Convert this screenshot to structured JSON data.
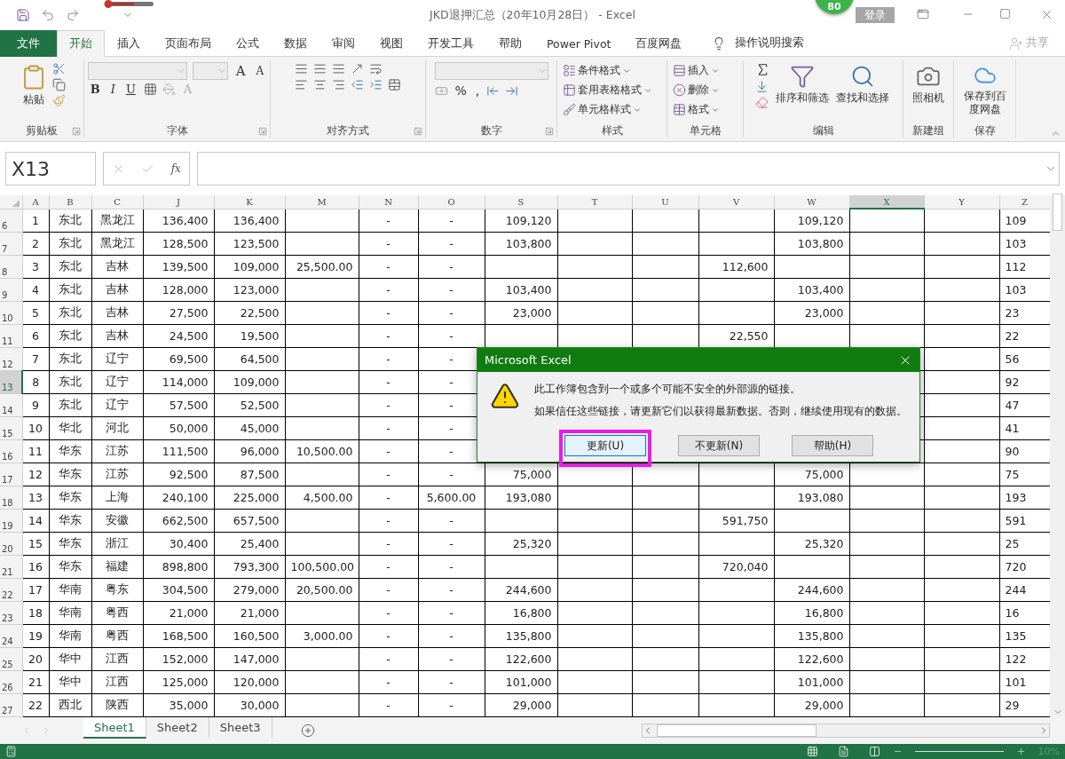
{
  "title_bar": {
    "title": "JKD退押汇总（20年10月28日） -  Excel",
    "badge": "80",
    "login": "登录"
  },
  "ribbon_tabs": [
    {
      "label": "文件",
      "kind": "file",
      "selected": false
    },
    {
      "label": "开始",
      "kind": "tab",
      "selected": true
    },
    {
      "label": "插入",
      "kind": "tab",
      "selected": false
    },
    {
      "label": "页面布局",
      "kind": "tab",
      "selected": false
    },
    {
      "label": "公式",
      "kind": "tab",
      "selected": false
    },
    {
      "label": "数据",
      "kind": "tab",
      "selected": false
    },
    {
      "label": "审阅",
      "kind": "tab",
      "selected": false
    },
    {
      "label": "视图",
      "kind": "tab",
      "selected": false
    },
    {
      "label": "开发工具",
      "kind": "tab",
      "selected": false
    },
    {
      "label": "帮助",
      "kind": "tab",
      "selected": false
    },
    {
      "label": "Power Pivot",
      "kind": "tab",
      "selected": false
    },
    {
      "label": "百度网盘",
      "kind": "tab",
      "selected": false
    }
  ],
  "tell_me": "操作说明搜索",
  "share": "共享",
  "ribbon_groups": [
    {
      "kind": "clipboard",
      "label": "剪贴板",
      "button": "粘贴"
    },
    {
      "kind": "font",
      "label": "字体",
      "size_buttons": [
        "A",
        "A"
      ],
      "style_buttons": [
        "B",
        "I",
        "U"
      ],
      "color_button": "A"
    },
    {
      "kind": "alignment",
      "label": "对齐方式"
    },
    {
      "kind": "number",
      "label": "数字",
      "symbols": [
        "%",
        ","
      ]
    },
    {
      "kind": "list",
      "label": "样式",
      "items": [
        "条件格式",
        "套用表格格式",
        "单元格样式"
      ]
    },
    {
      "kind": "list",
      "label": "单元格",
      "items": [
        "插入",
        "删除",
        "格式"
      ]
    },
    {
      "kind": "editing",
      "label": "编辑",
      "items": [
        "排序和筛选",
        "查找和选择"
      ]
    },
    {
      "kind": "camera",
      "label": "新建组",
      "button": "照相机"
    },
    {
      "kind": "cloud",
      "label": "保存",
      "button": "保存到百度网盘"
    }
  ],
  "formula_bar": {
    "name_box": "X13",
    "fx": "fx"
  },
  "columns": [
    {
      "label": "A",
      "kind": "center",
      "selected": false
    },
    {
      "label": "B",
      "kind": "center",
      "selected": false
    },
    {
      "label": "C",
      "kind": "center",
      "selected": false
    },
    {
      "label": "J",
      "kind": "number",
      "selected": false
    },
    {
      "label": "K",
      "kind": "number",
      "selected": false
    },
    {
      "label": "M",
      "kind": "number",
      "selected": false
    },
    {
      "label": "N",
      "kind": "center",
      "selected": false
    },
    {
      "label": "O",
      "kind": "dash",
      "selected": false
    },
    {
      "label": "S",
      "kind": "number",
      "selected": false
    },
    {
      "label": "T",
      "kind": "number",
      "selected": false
    },
    {
      "label": "U",
      "kind": "number",
      "selected": false
    },
    {
      "label": "V",
      "kind": "number",
      "selected": false
    },
    {
      "label": "W",
      "kind": "number",
      "selected": false
    },
    {
      "label": "X",
      "kind": "number",
      "selected": true
    },
    {
      "label": "Y",
      "kind": "number",
      "selected": false
    },
    {
      "label": "Z",
      "kind": "cut",
      "selected": false
    }
  ],
  "rows": [
    {
      "number": "6",
      "selected": false,
      "cells": [
        "1",
        "东北",
        "黑龙江",
        "136,400",
        "136,400",
        null,
        "-",
        "-",
        "109,120",
        null,
        null,
        null,
        "109,120",
        null,
        null,
        "109"
      ]
    },
    {
      "number": "7",
      "selected": false,
      "cells": [
        "2",
        "东北",
        "黑龙江",
        "128,500",
        "123,500",
        null,
        "-",
        "-",
        "103,800",
        null,
        null,
        null,
        "103,800",
        null,
        null,
        "103"
      ]
    },
    {
      "number": "8",
      "selected": false,
      "cells": [
        "3",
        "东北",
        "吉林",
        "139,500",
        "109,000",
        "25,500.00",
        "-",
        "-",
        null,
        null,
        null,
        "112,600",
        null,
        null,
        null,
        "112"
      ]
    },
    {
      "number": "9",
      "selected": false,
      "cells": [
        "4",
        "东北",
        "吉林",
        "128,000",
        "123,000",
        null,
        "-",
        "-",
        "103,400",
        null,
        null,
        null,
        "103,400",
        null,
        null,
        "103"
      ]
    },
    {
      "number": "10",
      "selected": false,
      "cells": [
        "5",
        "东北",
        "吉林",
        "27,500",
        "22,500",
        null,
        "-",
        "-",
        "23,000",
        null,
        null,
        null,
        "23,000",
        null,
        null,
        "23"
      ]
    },
    {
      "number": "11",
      "selected": false,
      "cells": [
        "6",
        "东北",
        "吉林",
        "24,500",
        "19,500",
        null,
        "-",
        "-",
        null,
        null,
        null,
        "22,550",
        null,
        null,
        null,
        "22"
      ]
    },
    {
      "number": "12",
      "selected": false,
      "cells": [
        "7",
        "东北",
        "辽宁",
        "69,500",
        "64,500",
        null,
        "-",
        "-",
        null,
        null,
        null,
        null,
        null,
        null,
        null,
        "56"
      ]
    },
    {
      "number": "13",
      "selected": true,
      "cells": [
        "8",
        "东北",
        "辽宁",
        "114,000",
        "109,000",
        null,
        "-",
        "-",
        null,
        null,
        null,
        null,
        null,
        null,
        null,
        "92"
      ]
    },
    {
      "number": "14",
      "selected": false,
      "cells": [
        "9",
        "东北",
        "辽宁",
        "57,500",
        "52,500",
        null,
        "-",
        "-",
        null,
        null,
        null,
        null,
        null,
        null,
        null,
        "47"
      ]
    },
    {
      "number": "15",
      "selected": false,
      "cells": [
        "10",
        "华北",
        "河北",
        "50,000",
        "45,000",
        null,
        "-",
        "-",
        null,
        null,
        null,
        null,
        null,
        null,
        null,
        "41"
      ]
    },
    {
      "number": "16",
      "selected": false,
      "cells": [
        "11",
        "华东",
        "江苏",
        "111,500",
        "96,000",
        "10,500.00",
        "-",
        "-",
        null,
        null,
        null,
        null,
        null,
        null,
        null,
        "90"
      ]
    },
    {
      "number": "17",
      "selected": false,
      "cells": [
        "12",
        "华东",
        "江苏",
        "92,500",
        "87,500",
        null,
        "-",
        "-",
        "75,000",
        null,
        null,
        null,
        "75,000",
        null,
        null,
        "75"
      ]
    },
    {
      "number": "18",
      "selected": false,
      "cells": [
        "13",
        "华东",
        "上海",
        "240,100",
        "225,000",
        "4,500.00",
        "-",
        "5,600.00",
        "193,080",
        null,
        null,
        null,
        "193,080",
        null,
        null,
        "193"
      ]
    },
    {
      "number": "19",
      "selected": false,
      "cells": [
        "14",
        "华东",
        "安徽",
        "662,500",
        "657,500",
        null,
        "-",
        "-",
        null,
        null,
        null,
        "591,750",
        null,
        null,
        null,
        "591"
      ]
    },
    {
      "number": "20",
      "selected": false,
      "cells": [
        "15",
        "华东",
        "浙江",
        "30,400",
        "25,400",
        null,
        "-",
        "-",
        "25,320",
        null,
        null,
        null,
        "25,320",
        null,
        null,
        "25"
      ]
    },
    {
      "number": "21",
      "selected": false,
      "cells": [
        "16",
        "华东",
        "福建",
        "898,800",
        "793,300",
        "100,500.00",
        "-",
        "-",
        null,
        null,
        null,
        "720,040",
        null,
        null,
        null,
        "720"
      ]
    },
    {
      "number": "22",
      "selected": false,
      "cells": [
        "17",
        "华南",
        "粤东",
        "304,500",
        "279,000",
        "20,500.00",
        "-",
        "-",
        "244,600",
        null,
        null,
        null,
        "244,600",
        null,
        null,
        "244"
      ]
    },
    {
      "number": "23",
      "selected": false,
      "cells": [
        "18",
        "华南",
        "粤西",
        "21,000",
        "21,000",
        null,
        "-",
        "-",
        "16,800",
        null,
        null,
        null,
        "16,800",
        null,
        null,
        "16"
      ]
    },
    {
      "number": "24",
      "selected": false,
      "cells": [
        "19",
        "华南",
        "粤西",
        "168,500",
        "160,500",
        "3,000.00",
        "-",
        "-",
        "135,800",
        null,
        null,
        null,
        "135,800",
        null,
        null,
        "135"
      ]
    },
    {
      "number": "25",
      "selected": false,
      "cells": [
        "20",
        "华中",
        "江西",
        "152,000",
        "147,000",
        null,
        "-",
        "-",
        "122,600",
        null,
        null,
        null,
        "122,600",
        null,
        null,
        "122"
      ]
    },
    {
      "number": "26",
      "selected": false,
      "cells": [
        "21",
        "华中",
        "江西",
        "125,000",
        "120,000",
        null,
        "-",
        "-",
        "101,000",
        null,
        null,
        null,
        "101,000",
        null,
        null,
        "101"
      ]
    },
    {
      "number": "27",
      "selected": false,
      "cells": [
        "22",
        "西北",
        "陕西",
        "35,000",
        "30,000",
        null,
        "-",
        "-",
        "29,000",
        null,
        null,
        null,
        "29,000",
        null,
        null,
        "29"
      ]
    }
  ],
  "dialog": {
    "title": "Microsoft Excel",
    "lines": [
      "此工作簿包含到一个或多个可能不安全的外部源的链接。",
      "如果信任这些链接，请更新它们以获得最新数据。否则，继续使用现有的数据。"
    ],
    "buttons": [
      {
        "label": "更新(U)",
        "selected": true,
        "highlighted": true
      },
      {
        "label": "不更新(N)",
        "selected": false,
        "highlighted": false
      },
      {
        "label": "帮助(H)",
        "selected": false,
        "highlighted": false
      }
    ]
  },
  "sheets": [
    {
      "label": "Sheet1",
      "selected": true
    },
    {
      "label": "Sheet2",
      "selected": false
    },
    {
      "label": "Sheet3",
      "selected": false
    }
  ],
  "status_bar": {
    "zoom": "10%"
  }
}
